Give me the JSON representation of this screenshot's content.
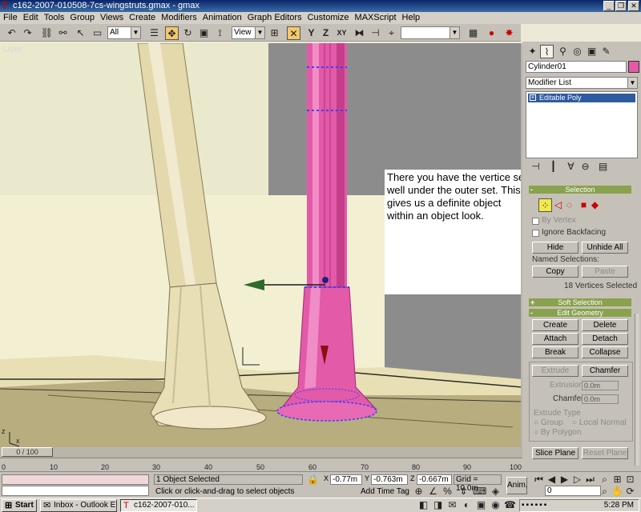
{
  "window": {
    "title": "c162-2007-010508-7cs-wingstruts.gmax - gmax"
  },
  "menu": [
    "File",
    "Edit",
    "Tools",
    "Group",
    "Views",
    "Create",
    "Modifiers",
    "Animation",
    "Graph Editors",
    "Customize",
    "MAXScript",
    "Help"
  ],
  "toolbar": {
    "selection_filter": "All",
    "ref_coord": "View"
  },
  "viewport": {
    "label": "User",
    "note": "There you have the vertice set well under the outer set.  This gives us a definite object within an object look."
  },
  "command_panel": {
    "object_name": "Cylinder01",
    "modifier_list": "Modifier List",
    "stack_item": "Editable Poly",
    "selection": {
      "header": "Selection",
      "by_vertex": "By Vertex",
      "ignore_backfacing": "Ignore Backfacing",
      "hide": "Hide",
      "unhide_all": "Unhide All",
      "named_selections": "Named Selections:",
      "copy": "Copy",
      "paste": "Paste",
      "status": "18 Vertices Selected"
    },
    "soft_selection": {
      "header": "Soft Selection",
      "pm": "+"
    },
    "edit_geometry": {
      "header": "Edit Geometry",
      "pm": "-",
      "create": "Create",
      "delete": "Delete",
      "attach": "Attach",
      "detach": "Detach",
      "break": "Break",
      "collapse": "Collapse",
      "extrude": "Extrude",
      "chamfer": "Chamfer",
      "extrusion_label": "Extrusion",
      "extrusion_value": "0.0m",
      "chamfer_label": "Chamfer",
      "chamfer_value": "0.0m",
      "extrude_type": "Extrude Type",
      "group": "Group",
      "local_normal": "Local Normal",
      "by_polygon": "By Polygon",
      "slice_plane": "Slice Plane",
      "reset_plane": "Reset Plane"
    }
  },
  "timeline": {
    "thumb": "0 / 100",
    "ticks": [
      "0",
      "10",
      "20",
      "30",
      "40",
      "50",
      "60",
      "70",
      "80",
      "90",
      "100"
    ]
  },
  "status": {
    "selected": "1 Object Selected",
    "prompt": "Click or click-and-drag to select objects",
    "x": "-0.77m",
    "y": "-0.763m",
    "z": "-0.667m",
    "grid": "Grid = 10.0m",
    "add_time_tag": "Add Time Tag",
    "anim": "Anim.",
    "frame": "0"
  },
  "taskbar": {
    "start": "Start",
    "items": [
      "Inbox - Outlook E...",
      "c162-2007-010..."
    ],
    "clock": "5:28 PM"
  },
  "colors": {
    "accent_green": "#8aa24d",
    "pink": "#e25aa8",
    "title_blue": "#0a246a"
  }
}
